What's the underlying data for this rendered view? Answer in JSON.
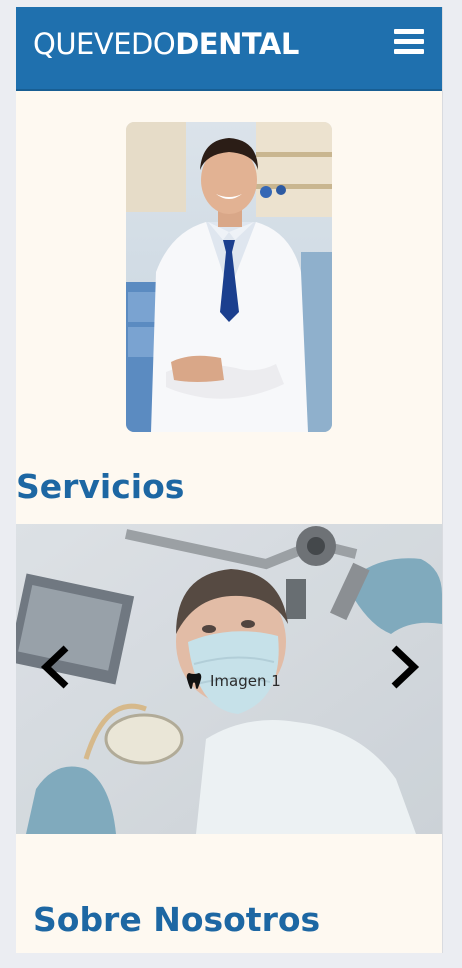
{
  "header": {
    "logo_light": "QUEVEDO",
    "logo_bold": "DENTAL",
    "menu_icon": "hamburger-menu-icon",
    "color": "#1f70ae"
  },
  "hero": {
    "image": "dentist-portrait-photo"
  },
  "servicios": {
    "title": "Servicios",
    "carousel": {
      "slide_caption": "Imagen 1",
      "caption_icon": "tooth-icon",
      "prev_icon": "chevron-left-icon",
      "next_icon": "chevron-right-icon"
    }
  },
  "about": {
    "title": "Sobre Nosotros"
  },
  "colors": {
    "brand": "#1f70ae",
    "heading": "#1d67a3",
    "page_bg": "#fef9f1"
  }
}
